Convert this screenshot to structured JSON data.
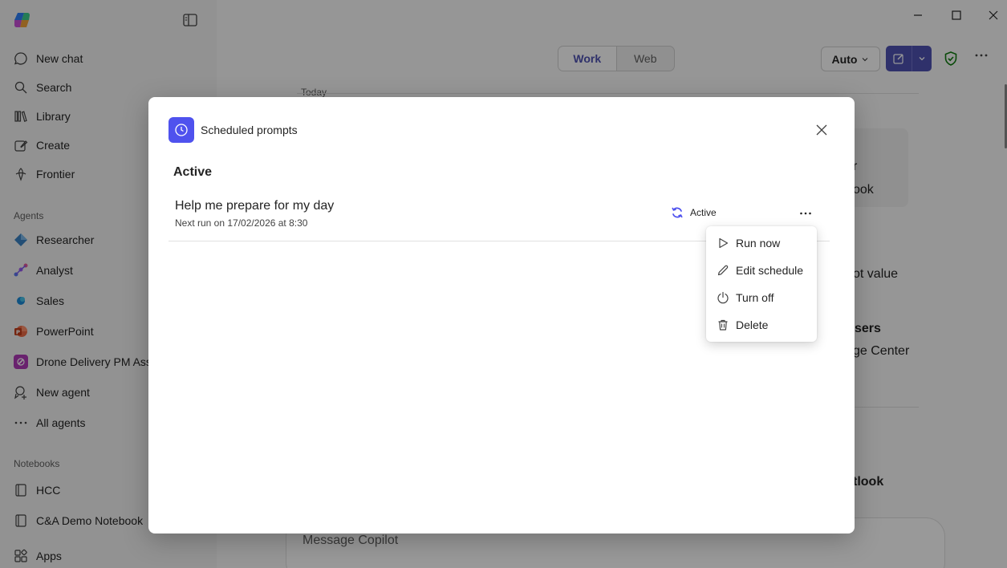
{
  "sidebar": {
    "nav": [
      {
        "label": "New chat",
        "icon": "chat-icon"
      },
      {
        "label": "Search",
        "icon": "search-icon"
      },
      {
        "label": "Library",
        "icon": "library-icon"
      },
      {
        "label": "Create",
        "icon": "create-icon"
      },
      {
        "label": "Frontier",
        "icon": "frontier-icon"
      }
    ],
    "agents_label": "Agents",
    "agents": [
      {
        "label": "Researcher",
        "color": "#3b82c4"
      },
      {
        "label": "Analyst",
        "color": "#7a5af0"
      },
      {
        "label": "Sales",
        "color": "#1c8ad8"
      },
      {
        "label": "PowerPoint",
        "color": "#c43e1c"
      },
      {
        "label": "Drone Delivery PM Ass",
        "color": "#b03ab8"
      }
    ],
    "new_agent": "New agent",
    "all_agents": "All agents",
    "notebooks_label": "Notebooks",
    "notebooks": [
      {
        "label": "HCC"
      },
      {
        "label": "C&A Demo Notebook"
      }
    ],
    "apps": "Apps"
  },
  "main": {
    "toggle": {
      "work": "Work",
      "web": "Web"
    },
    "model": "Auto",
    "today": "Today",
    "bg_fragments": [
      "r",
      "ook",
      "ot value",
      "sers",
      "ge Center",
      "tlook"
    ],
    "composer_placeholder": "Message Copilot",
    "colors": {
      "accent": "#4f52b2",
      "shield": "#107c10"
    }
  },
  "dialog": {
    "title": "Scheduled prompts",
    "section": "Active",
    "prompts": [
      {
        "title": "Help me prepare for my day",
        "next_run": "Next run on 17/02/2026 at 8:30",
        "status": "Active"
      }
    ]
  },
  "menu": {
    "items": [
      {
        "label": "Run now",
        "icon": "play-icon"
      },
      {
        "label": "Edit schedule",
        "icon": "pencil-icon"
      },
      {
        "label": "Turn off",
        "icon": "power-icon"
      },
      {
        "label": "Delete",
        "icon": "trash-icon"
      }
    ]
  }
}
